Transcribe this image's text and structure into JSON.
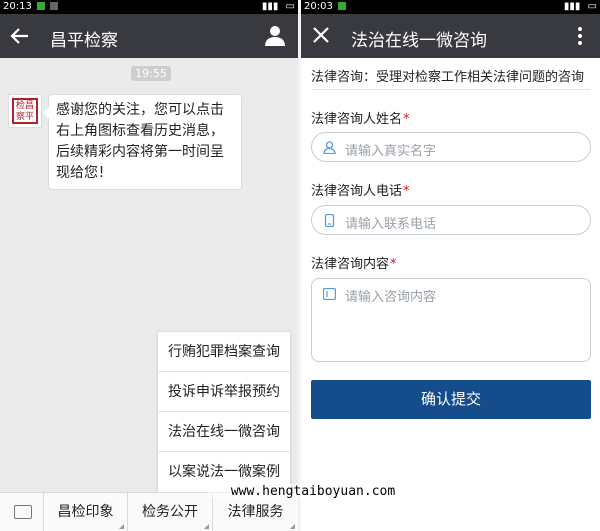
{
  "left_phone": {
    "status": {
      "time": "20:13"
    },
    "header": {
      "title": "昌平检察"
    },
    "chat": {
      "timestamp": "19:55",
      "avatar_text": [
        "检",
        "昌",
        "察",
        "平"
      ],
      "message": "感谢您的关注，您可以点击右上角图标查看历史消息，后续精彩内容将第一时间呈现给您！"
    },
    "popup_menu": [
      "行贿犯罪档案查询",
      "投诉申诉举报预约",
      "法治在线一微咨询",
      "以案说法一微案例"
    ],
    "bottom_tabs": [
      "昌检印象",
      "检务公开",
      "法律服务"
    ]
  },
  "right_phone": {
    "status": {
      "time": "20:03"
    },
    "header": {
      "title": "法治在线一微咨询"
    },
    "intro": "法律咨询：受理对检察工作相关法律问题的咨询",
    "fields": {
      "name": {
        "label": "法律咨询人姓名",
        "required_mark": "*",
        "placeholder": "请输入真实名字"
      },
      "phone": {
        "label": "法律咨询人电话",
        "required_mark": "*",
        "placeholder": "请输入联系电话"
      },
      "content": {
        "label": "法律咨询内容",
        "required_mark": "*",
        "placeholder": "请输入咨询内容"
      }
    },
    "submit_label": "确认提交",
    "colors": {
      "accent": "#144c8c",
      "required": "#dd1122",
      "appbar": "#393a3f"
    }
  },
  "watermark": "www.hengtaiboyuan.com"
}
